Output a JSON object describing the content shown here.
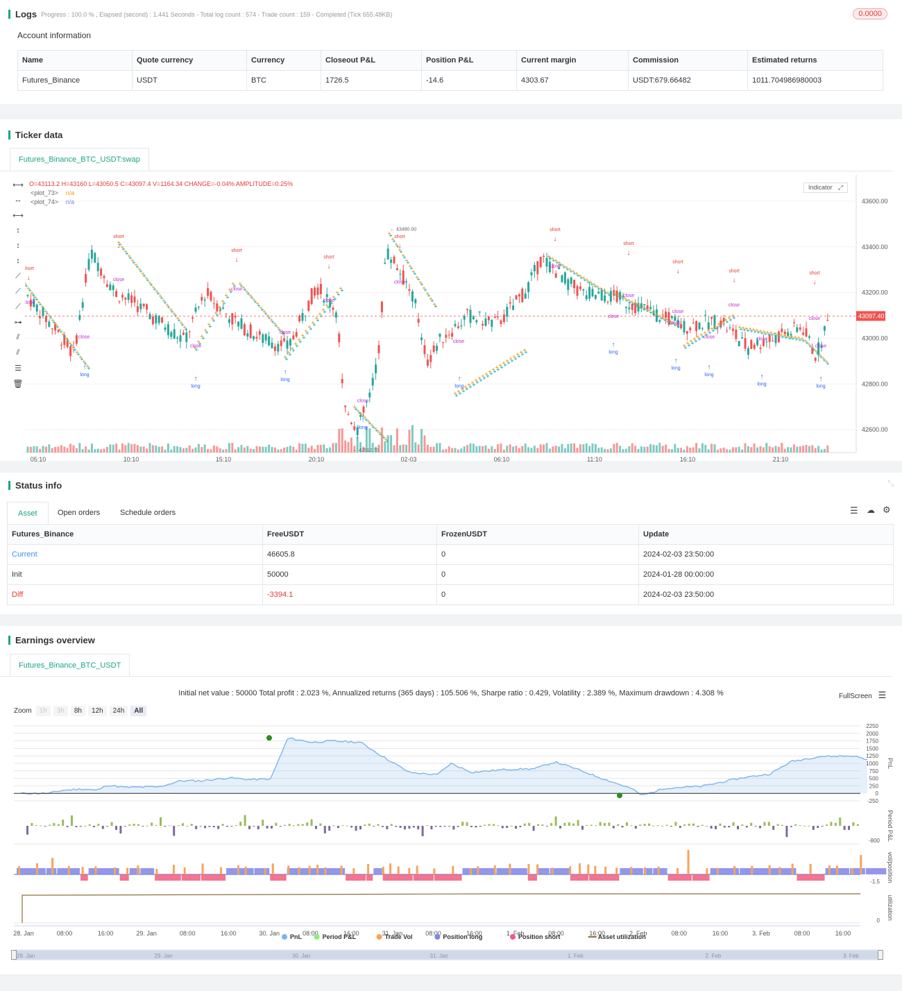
{
  "logs": {
    "title": "Logs",
    "progress": "Progress : 100.0 % , Elapsed (second) : 1.441 Seconds - Total log count : 574 - Trade count : 159 - Completed (Tick 655.48KB)",
    "badge": "0.0000",
    "account_title": "Account information",
    "headers": [
      "Name",
      "Quote currency",
      "Currency",
      "Closeout P&L",
      "Position P&L",
      "Current margin",
      "Commission",
      "Estimated returns"
    ],
    "row": [
      "Futures_Binance",
      "USDT",
      "BTC",
      "1726.5",
      "-14.6",
      "4303.67",
      "USDT:679.66482",
      "1011.704986980003"
    ]
  },
  "ticker": {
    "title": "Ticker data",
    "tab": "Futures_Binance_BTC_USDT:swap",
    "ohlc": "O=43113.2 H=43160 L=43050.5 C=43097.4 V=1164.34 CHANGE=-0.04% AMPLITUDE=0.25%",
    "legend": [
      {
        "name": "<plot_73>",
        "value": "n/a"
      },
      {
        "name": "<plot_74>",
        "value": "n/a"
      }
    ],
    "indicator_btn": "Indicator",
    "price_axis": [
      "43600.00",
      "43400.00",
      "43200.00",
      "43000.00",
      "42800.00",
      "42600.00"
    ],
    "current_price": "43097.40",
    "time_axis": [
      "05:10",
      "10:10",
      "15:10",
      "20:10",
      "02-03",
      "06:10",
      "11:10",
      "16:10",
      "21:10"
    ],
    "high_label": "43480.00",
    "low_label": "42512.70",
    "signal_short": "short",
    "signal_long": "long",
    "signal_close": "close",
    "colors": {
      "up": "#26a69a",
      "down": "#ef5350",
      "plot_a": "#f39c12",
      "plot_b": "#20b2c8",
      "short": "#e53935",
      "long": "#2962ff",
      "close": "#c026d3"
    }
  },
  "status": {
    "title": "Status info",
    "tabs": [
      "Asset",
      "Open orders",
      "Schedule orders"
    ],
    "headers": [
      "Futures_Binance",
      "FreeUSDT",
      "FrozenUSDT",
      "Update"
    ],
    "rows": [
      [
        "Current",
        "46605.8",
        "0",
        "2024-02-03 23:50:00"
      ],
      [
        "Init",
        "50000",
        "0",
        "2024-01-28 00:00:00"
      ],
      [
        "Diff",
        "-3394.1",
        "0",
        "2024-02-03 23:50:00"
      ]
    ]
  },
  "earnings": {
    "title": "Earnings overview",
    "tab": "Futures_Binance_BTC_USDT",
    "summary": "Initial net value : 50000 Total profit : 2.023 %, Annualized returns (365 days) : 105.506 %, Sharpe ratio : 0.429, Volatility : 2.389 %, Maximum drawdown : 4.308 %",
    "fullscreen": "FullScreen",
    "zoom_label": "Zoom",
    "zoom": [
      "1h",
      "3h",
      "8h",
      "12h",
      "24h",
      "All"
    ],
    "pnl_axis": [
      "2250",
      "2000",
      "1750",
      "1500",
      "1250",
      "1000",
      "750",
      "500",
      "250",
      "0",
      "-250"
    ],
    "pnl_label": "PnL",
    "period_label": "Period P&L",
    "period_min": "-800",
    "vol_label": "vol/position",
    "vol_min": "-1.5",
    "util_label": "utilization",
    "util_min": "0",
    "time_axis": [
      "28. Jan",
      "08:00",
      "16:00",
      "29. Jan",
      "08:00",
      "16:00",
      "30. Jan",
      "08:00",
      "16:00",
      "31. Jan",
      "08:00",
      "16:00",
      "1. Feb",
      "08:00",
      "16:00",
      "2. Feb",
      "08:00",
      "16:00",
      "3. Feb",
      "08:00",
      "16:00"
    ],
    "legend": [
      {
        "name": "PnL",
        "color": "#7cb5ec"
      },
      {
        "name": "Period P&L",
        "color": "#90ed7d"
      },
      {
        "name": "Trade Vol",
        "color": "#f7a35c"
      },
      {
        "name": "Position long",
        "color": "#8085e9"
      },
      {
        "name": "Position short",
        "color": "#f15c80"
      },
      {
        "name": "Asset utilization",
        "color": "#8d6e3f"
      }
    ],
    "navigator": [
      "28. Jan",
      "29. Jan",
      "30. Jan",
      "31. Jan",
      "1. Feb",
      "2. Feb",
      "3. Feb"
    ]
  }
}
